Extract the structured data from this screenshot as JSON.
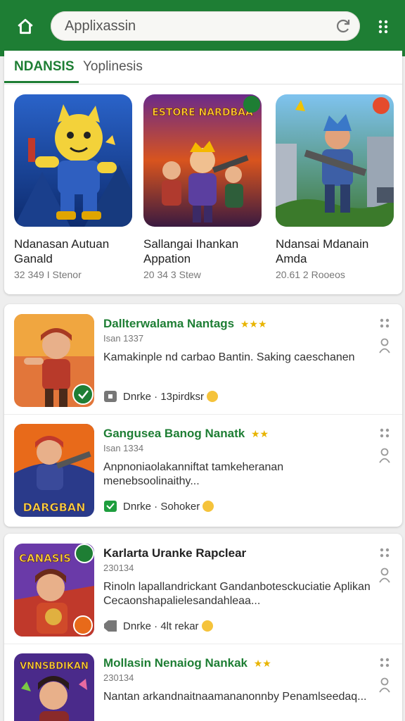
{
  "search": {
    "value": "Applixassin",
    "placeholder": "Applixassin"
  },
  "tabs": [
    {
      "label": "NDANSIS",
      "active": true
    },
    {
      "label": "Yoplinesis",
      "active": false
    }
  ],
  "featured": [
    {
      "name": "Ndanasan Autuan Ganald",
      "meta": "32 349 I Stenor"
    },
    {
      "name": "Sallangai Ihankan Appation",
      "meta": "20 34 3 Stew"
    },
    {
      "name": "Ndansai Mdanain Amda",
      "meta": "20.61 2 Rooeos"
    }
  ],
  "featured_art": [
    {
      "title_text": ""
    },
    {
      "title_text": "ESTORE NARDBAA"
    },
    {
      "title_text": ""
    }
  ],
  "list": [
    {
      "title": "Dallterwalama Nantags",
      "stars": "★★★",
      "sub": "Isan 1337",
      "desc": "Kamakinple nd carbao Bantin. Saking caeschanen",
      "action": "Dnrke · 13pirdksr"
    },
    {
      "title": "Gangusea Banog Nanatk",
      "stars": "★★",
      "sub": "Isan 1334",
      "desc": "Anpnoniaolakanniftat tamkeheranan menebsoolinaithy...",
      "action": "Dnrke · Sohoker"
    },
    {
      "title": "Karlarta Uranke Rapclear",
      "stars": "",
      "sub": "230134",
      "desc": "Rinoln lapallandrickant Gandanbotesckuciatie Aplikan Cecaonshapalielesandahleaa...",
      "action": "Dnrke · 4lt rekar"
    },
    {
      "title": "Mollasin Nenaiog Nankak",
      "stars": "★★",
      "sub": "230134",
      "desc": "Nantan arkandnaitnaamananonnby Penamlseedaq...",
      "action": ""
    }
  ],
  "list_art": [
    {
      "title_text": ""
    },
    {
      "title_text": "DARGBAN"
    },
    {
      "title_text": "CANASIS"
    },
    {
      "title_text": "VNNSBDIKAN"
    }
  ],
  "colors": {
    "brand": "#1e7e34",
    "accent_star": "#e8b400"
  },
  "icons": [
    "home-icon",
    "refresh-icon",
    "menu-dots-icon",
    "more-dots-icon",
    "person-icon",
    "tag-icon",
    "message-icon"
  ]
}
